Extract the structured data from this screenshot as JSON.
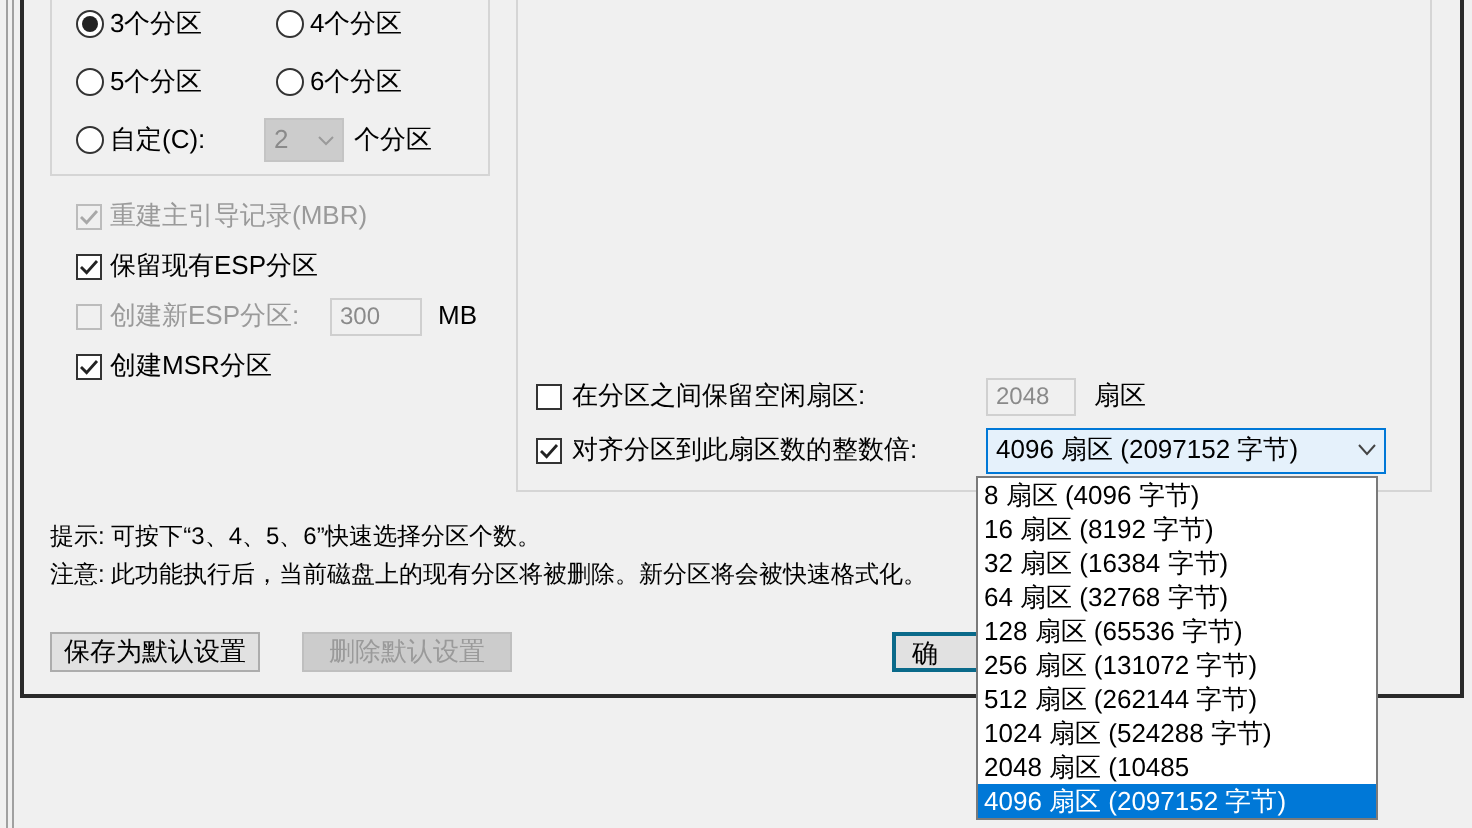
{
  "partition_count": {
    "options": [
      {
        "kind": "radio",
        "label": "3个分区",
        "selected": true
      },
      {
        "kind": "radio",
        "label": "4个分区",
        "selected": false
      },
      {
        "kind": "radio",
        "label": "5个分区",
        "selected": false
      },
      {
        "kind": "radio",
        "label": "6个分区",
        "selected": false
      },
      {
        "kind": "custom",
        "label": "自定(C):",
        "selected": false,
        "value": "2",
        "disabled": true,
        "unit": "个分区"
      }
    ]
  },
  "options": [
    {
      "kind": "checkbox",
      "label": "重建主引导记录(MBR)",
      "checked": true,
      "disabled": true
    },
    {
      "kind": "checkbox",
      "label": "保留现有ESP分区",
      "checked": true,
      "disabled": false
    },
    {
      "kind": "checkbox_input",
      "label": "创建新ESP分区:",
      "checked": false,
      "disabled": true,
      "value": "300",
      "unit": "MB"
    },
    {
      "kind": "checkbox",
      "label": "创建MSR分区",
      "checked": true,
      "disabled": false
    }
  ],
  "alignment": {
    "reserve": {
      "label": "在分区之间保留空闲扇区:",
      "checked": false,
      "value": "2048",
      "unit": "扇区",
      "disabled": true
    },
    "align": {
      "label": "对齐分区到此扇区数的整数倍:",
      "checked": true,
      "value": "4096 扇区 (2097152 字节)",
      "expanded": true
    },
    "dropdown_items": [
      {
        "label": "8 扇区 (4096 字节)",
        "selected": false
      },
      {
        "label": "16 扇区 (8192 字节)",
        "selected": false
      },
      {
        "label": "32 扇区 (16384 字节)",
        "selected": false
      },
      {
        "label": "64 扇区 (32768 字节)",
        "selected": false
      },
      {
        "label": "128 扇区 (65536 字节)",
        "selected": false
      },
      {
        "label": "256 扇区 (131072 字节)",
        "selected": false
      },
      {
        "label": "512 扇区 (262144 字节)",
        "selected": false
      },
      {
        "label": "1024 扇区 (524288 字节)",
        "selected": false
      },
      {
        "label": "2048 扇区 (10485",
        "selected": false
      },
      {
        "label": "4096 扇区 (2097152 字节)",
        "selected": true
      }
    ]
  },
  "notes": [
    "提示: 可按下“3、4、5、6”快速选择分区个数。",
    "注意: 此功能执行后，当前磁盘上的现有分区将被删除。新分区将会被快速格式化。"
  ],
  "buttons": [
    {
      "label": "保存为默认设置",
      "disabled": false
    },
    {
      "label": "删除默认设置",
      "disabled": true
    },
    {
      "label": "确",
      "disabled": false,
      "default": true
    }
  ]
}
